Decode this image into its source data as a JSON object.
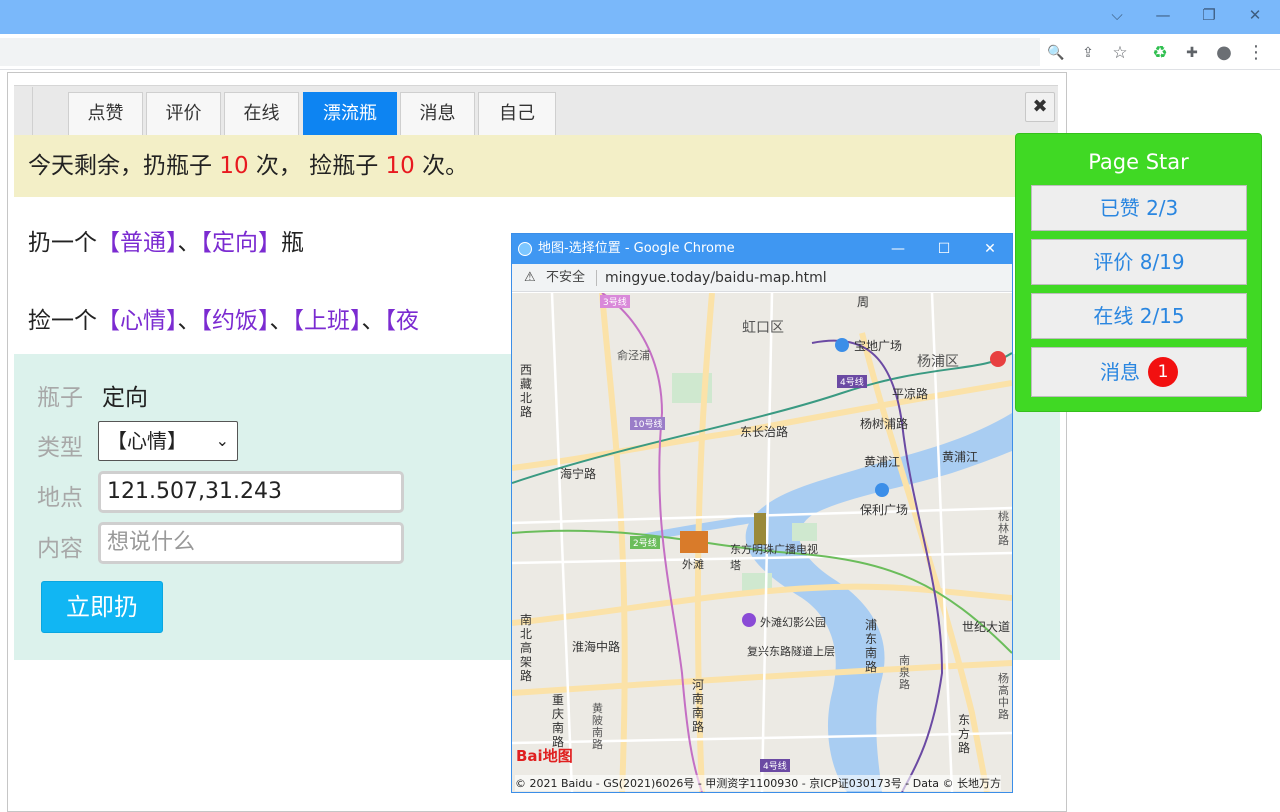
{
  "browser": {
    "window_controls": {
      "collapse": "⌵",
      "minimize": "—",
      "restore": "❐",
      "close": "✕"
    },
    "toolbar_icons": [
      "zoom-icon",
      "share-icon",
      "bookmark-star-icon",
      "extension-recycle-icon",
      "puzzle-icon",
      "profile-icon",
      "menu-icon"
    ],
    "toolbar_glyphs": {
      "zoom": "🔍",
      "share": "⇪",
      "star": "☆",
      "recycle": "♻",
      "puzzle": "✚",
      "profile": "●",
      "menu": "⋮"
    }
  },
  "tabs": [
    {
      "label": "点赞",
      "active": false
    },
    {
      "label": "评价",
      "active": false
    },
    {
      "label": "在线",
      "active": false
    },
    {
      "label": "漂流瓶",
      "active": true
    },
    {
      "label": "消息",
      "active": false
    },
    {
      "label": "自己",
      "active": false
    }
  ],
  "close_button": "✖",
  "quota": {
    "prefix": "今天剩余，扔瓶子 ",
    "throw_count": "10",
    "middle": " 次， 捡瓶子 ",
    "pick_count": "10",
    "suffix": " 次。"
  },
  "throw_line": {
    "prefix": "扔一个",
    "link_normal": "【普通】",
    "sep": "、",
    "link_directed": "【定向】",
    "suffix": "瓶"
  },
  "pick_line": {
    "prefix": "捡一个",
    "links": [
      "【心情】",
      "【约饭】",
      "【上班】",
      "【夜"
    ],
    "sep": "、"
  },
  "form": {
    "bottle_label": "瓶子",
    "bottle_value": "定向",
    "type_label": "类型",
    "type_selected": "【心情】",
    "location_label": "地点",
    "location_value": "121.507,31.243",
    "content_label": "内容",
    "content_placeholder": "想说什么",
    "submit_label": "立即扔"
  },
  "star_panel": {
    "title": "Page Star",
    "likes": "已赞  2/3",
    "reviews": "评价 8/19",
    "online": "在线 2/15",
    "messages_label": "消息",
    "messages_badge": "1",
    "accent_color": "#40d924"
  },
  "popup": {
    "window_title": "地图-选择位置 - Google Chrome",
    "security_label": "不安全",
    "url": "mingyue.today/baidu-map.html",
    "controls": {
      "minimize": "—",
      "maximize": "☐",
      "close": "✕"
    },
    "map": {
      "districts": [
        "虹口区",
        "杨浦区"
      ],
      "roads": [
        "西藏北路",
        "俞泾浦",
        "东长治路",
        "杨树浦路",
        "平凉路",
        "海宁路",
        "黄浦江",
        "黄浦江",
        "南北高架路",
        "淮海中路",
        "河南南路",
        "复兴东路隧道上层",
        "浦东南路",
        "南泉路",
        "世纪大道",
        "东方路",
        "重庆南路",
        "黄陂南路",
        "桃林路",
        "杨高中路"
      ],
      "pois": [
        "宝地广场",
        "保利广场",
        "外滩",
        "东方明珠广播电视塔",
        "外滩幻影公园",
        "周"
      ],
      "metro_lines": [
        "3号线",
        "4号线",
        "10号线",
        "2号线",
        "4号线"
      ],
      "logo_text": "Bai地图",
      "copyright": "© 2021 Baidu - GS(2021)6026号 - 甲测资字1100930 - 京ICP证030173号 - Data © 长地万方"
    }
  }
}
